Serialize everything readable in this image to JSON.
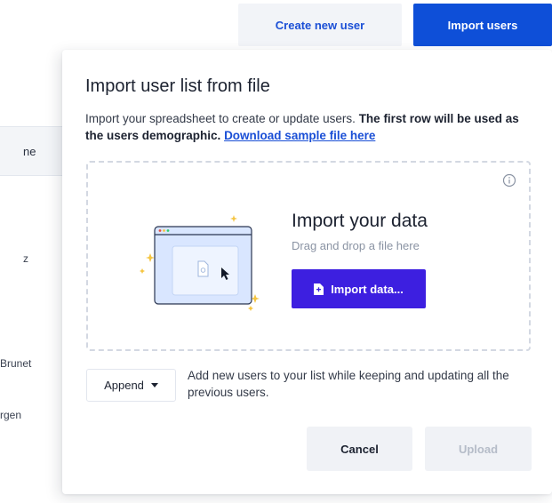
{
  "background": {
    "create_user_label": "Create new user",
    "import_users_label": "Import users",
    "table_header_fragment": "ne",
    "row_fragments": [
      "z",
      "Brunet",
      "rgen"
    ]
  },
  "modal": {
    "title": "Import user list from file",
    "description": "Import your spreadsheet to create or update users.",
    "description_strong": "The first row will be used as the users demographic.",
    "download_link": "Download sample file here",
    "dropzone": {
      "title": "Import your data",
      "subtitle": "Drag and drop a file here",
      "button_label": "Import data..."
    },
    "append_label": "Append",
    "append_description": "Add new users to your list while keeping and updating all the previous users.",
    "cancel_label": "Cancel",
    "upload_label": "Upload"
  },
  "colors": {
    "primary_blue": "#0e4fd8",
    "import_purple": "#3d1fe0",
    "link_blue": "#1a4fd6"
  }
}
